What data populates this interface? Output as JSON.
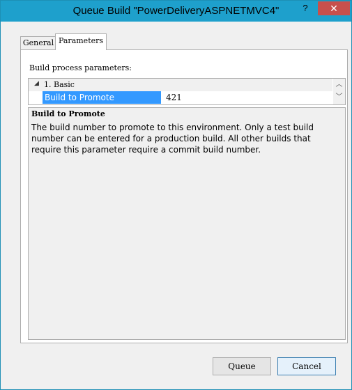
{
  "window": {
    "title": "Queue Build \"PowerDeliveryASPNETMVC4\"",
    "help_label": "?",
    "close_label": "✕"
  },
  "tabs": [
    {
      "label": "General",
      "selected": false
    },
    {
      "label": "Parameters",
      "selected": true
    }
  ],
  "parameters": {
    "section_label": "Build process parameters:",
    "category": {
      "toggle": "◢",
      "label": "1. Basic"
    },
    "property": {
      "name": "Build to Promote",
      "value": "421"
    },
    "scroll_up": "︿",
    "scroll_down": "﹀"
  },
  "description": {
    "title": "Build to Promote",
    "text": "The build number to promote to this environment. Only a test build number can be entered for a production build. All other builds that require this parameter require a commit build number."
  },
  "buttons": {
    "queue_label": "Queue",
    "cancel_label": "Cancel"
  },
  "colors": {
    "titlebar": "#1ea0cc",
    "close": "#c7504c",
    "selection": "#3399ff"
  }
}
